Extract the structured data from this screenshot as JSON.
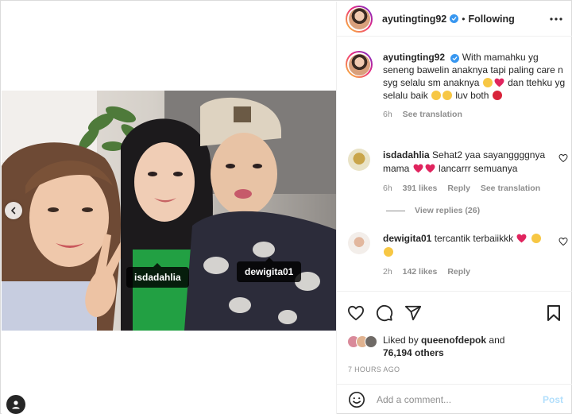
{
  "post": {
    "author": "ayutingting92",
    "follow_status": "Following",
    "separator": "•",
    "caption_text": "With mamahku yg seneng bawelin anaknya tapi paling care n syg selalu sm anaknya",
    "caption_text2": "dan ttehku yg selalu baik",
    "caption_text3": "luv both",
    "caption_age": "6h",
    "see_translation": "See translation",
    "tags": [
      "isdadahlia",
      "dewigita01"
    ]
  },
  "comments": [
    {
      "user": "isdadahlia",
      "text_a": "Sehat2 yaa sayanggggnya mama",
      "text_b": "lancarrr semuanya",
      "age": "6h",
      "likes": "391 likes",
      "reply": "Reply",
      "see_translation": "See translation",
      "view_replies": "View replies (26)"
    },
    {
      "user": "dewigita01",
      "text_a": "tercantik terbaiikkk",
      "age": "2h",
      "likes": "142 likes",
      "reply": "Reply"
    }
  ],
  "likes": {
    "prefix": "Liked by",
    "user": "queenofdepok",
    "and": "and",
    "others": "76,194 others"
  },
  "timestamp": "7 HOURS AGO",
  "add_comment": {
    "placeholder": "Add a comment...",
    "post_label": "Post"
  },
  "colors": {
    "verified": "#3897f0",
    "heart": "#ed4956",
    "post_disabled": "#b2dffc",
    "muted": "#8e8e8e"
  },
  "icons": [
    "more-icon",
    "verified-icon",
    "heart-icon",
    "comment-icon",
    "share-icon",
    "bookmark-icon",
    "emoji-icon",
    "carousel-prev-icon",
    "user-tags-icon"
  ]
}
